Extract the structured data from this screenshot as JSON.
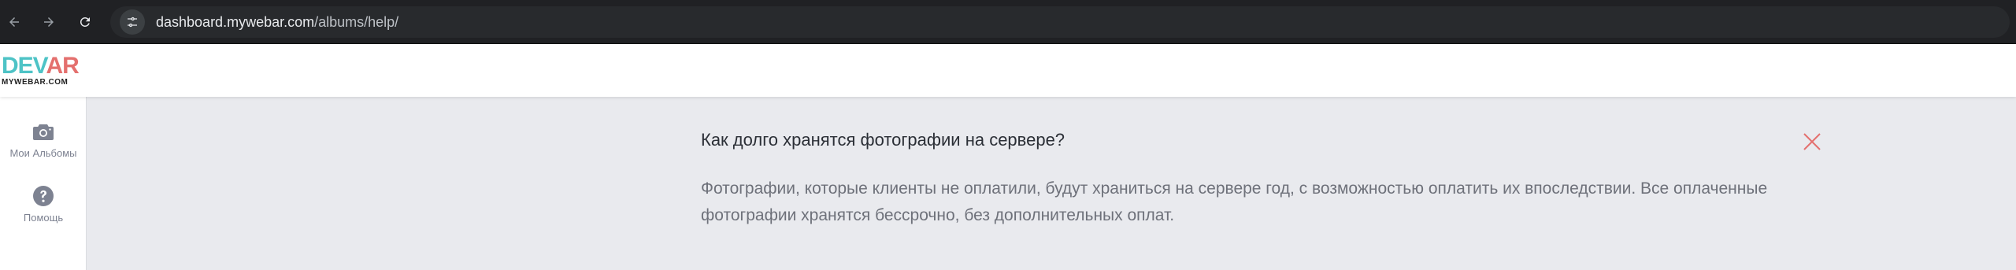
{
  "browser": {
    "url_host": "dashboard.mywebar.com",
    "url_path": "/albums/help/",
    "icons": {
      "back": "arrow-left-icon",
      "forward": "arrow-right-icon",
      "reload": "reload-icon",
      "site_info": "tune-icon"
    }
  },
  "header": {
    "logo_mark_main": "DEV",
    "logo_mark_accent": "AR",
    "logo_sub": "MYWEBAR.COM"
  },
  "sidebar": {
    "items": [
      {
        "label": "Мои Альбомы",
        "icon": "camera-icon"
      },
      {
        "label": "Помощь",
        "icon": "question-circle-icon"
      }
    ]
  },
  "faq": {
    "question": "Как долго хранятся фотографии на сервере?",
    "answer": "Фотографии, которые клиенты не оплатили, будут храниться на сервере год, с возможностью оплатить их впоследствии. Все оплаченные фотографии хранятся бессрочно, без дополнительных оплат.",
    "close_icon": "close-icon"
  },
  "colors": {
    "browser_bg": "#202124",
    "content_bg": "#e9eaee",
    "close_accent": "#e4706e",
    "sidebar_icon": "#7d8291",
    "logo_teal": "#4ec3c6",
    "logo_coral": "#e4706e"
  }
}
